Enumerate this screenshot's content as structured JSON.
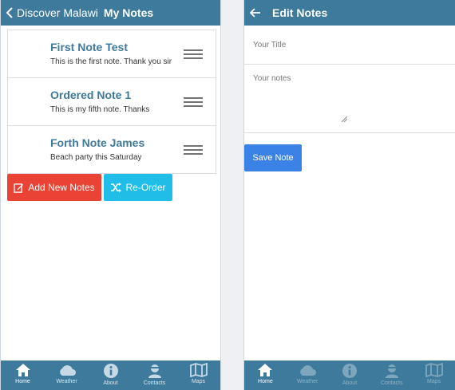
{
  "left_screen": {
    "back_label": "Discover Malawi",
    "title": "My Notes",
    "notes": [
      {
        "title": "First Note Test",
        "body": "This is the first note. Thank you sir"
      },
      {
        "title": "Ordered Note 1",
        "body": "This is my fifth note. Thanks"
      },
      {
        "title": "Forth Note James",
        "body": "Beach party this Saturday"
      }
    ],
    "add_button": "Add New Notes",
    "reorder_button": "Re-Order",
    "colors": {
      "header": "#3e7a9c",
      "add": "#ea4335",
      "reorder": "#1fbde8",
      "note_title": "#3e7a9c"
    }
  },
  "right_screen": {
    "title": "Edit Notes",
    "title_placeholder": "Your Title",
    "notes_placeholder": "Your notes",
    "save_button": "Save Note",
    "colors": {
      "save": "#3b82e6"
    }
  },
  "tabbar_left": [
    {
      "label": "Home",
      "icon": "home-icon"
    },
    {
      "label": "Weather",
      "icon": "cloud-icon"
    },
    {
      "label": "About",
      "icon": "info-icon"
    },
    {
      "label": "Contacts",
      "icon": "person-icon"
    },
    {
      "label": "Maps",
      "icon": "map-icon"
    }
  ],
  "tabbar_right": [
    {
      "label": "Home",
      "icon": "home-icon"
    },
    {
      "label": "Weather",
      "icon": "cloud-icon"
    },
    {
      "label": "About",
      "icon": "info-icon"
    },
    {
      "label": "Contacts",
      "icon": "person-icon"
    },
    {
      "label": "Maps",
      "icon": "map-icon"
    }
  ]
}
